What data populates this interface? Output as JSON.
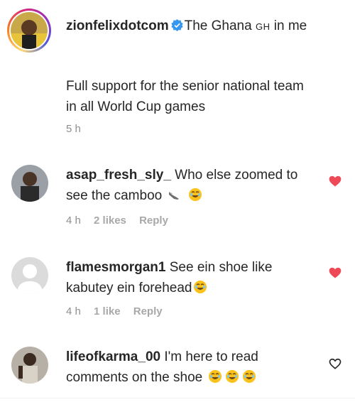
{
  "caption": {
    "username": "zionfelixdotcom",
    "text_part1": "The Ghana ",
    "flag": "GH",
    "text_part2": " in me",
    "text_line2": "Full support for the senior national team in all World Cup games",
    "time": "5 h"
  },
  "comments": [
    {
      "username": "asap_fresh_sly_",
      "text": "Who else zoomed to see the camboo",
      "time": "4 h",
      "likes": "2 likes",
      "reply": "Reply",
      "liked": true
    },
    {
      "username": "flamesmorgan1",
      "text": "See ein shoe like kabutey ein forehead",
      "time": "4 h",
      "likes": "1 like",
      "reply": "Reply",
      "liked": true
    },
    {
      "username": "lifeofkarma_00",
      "text": "I'm here to read comments on the shoe",
      "liked": false
    }
  ],
  "colors": {
    "heart_red": "#ed4956",
    "verified_blue": "#3897f0",
    "meta_gray": "#8e8e8e"
  },
  "icons": [
    "verified-badge-icon",
    "heart-filled-icon",
    "heart-outline-icon",
    "laughing-emoji-icon",
    "shoe-emoji-icon"
  ]
}
